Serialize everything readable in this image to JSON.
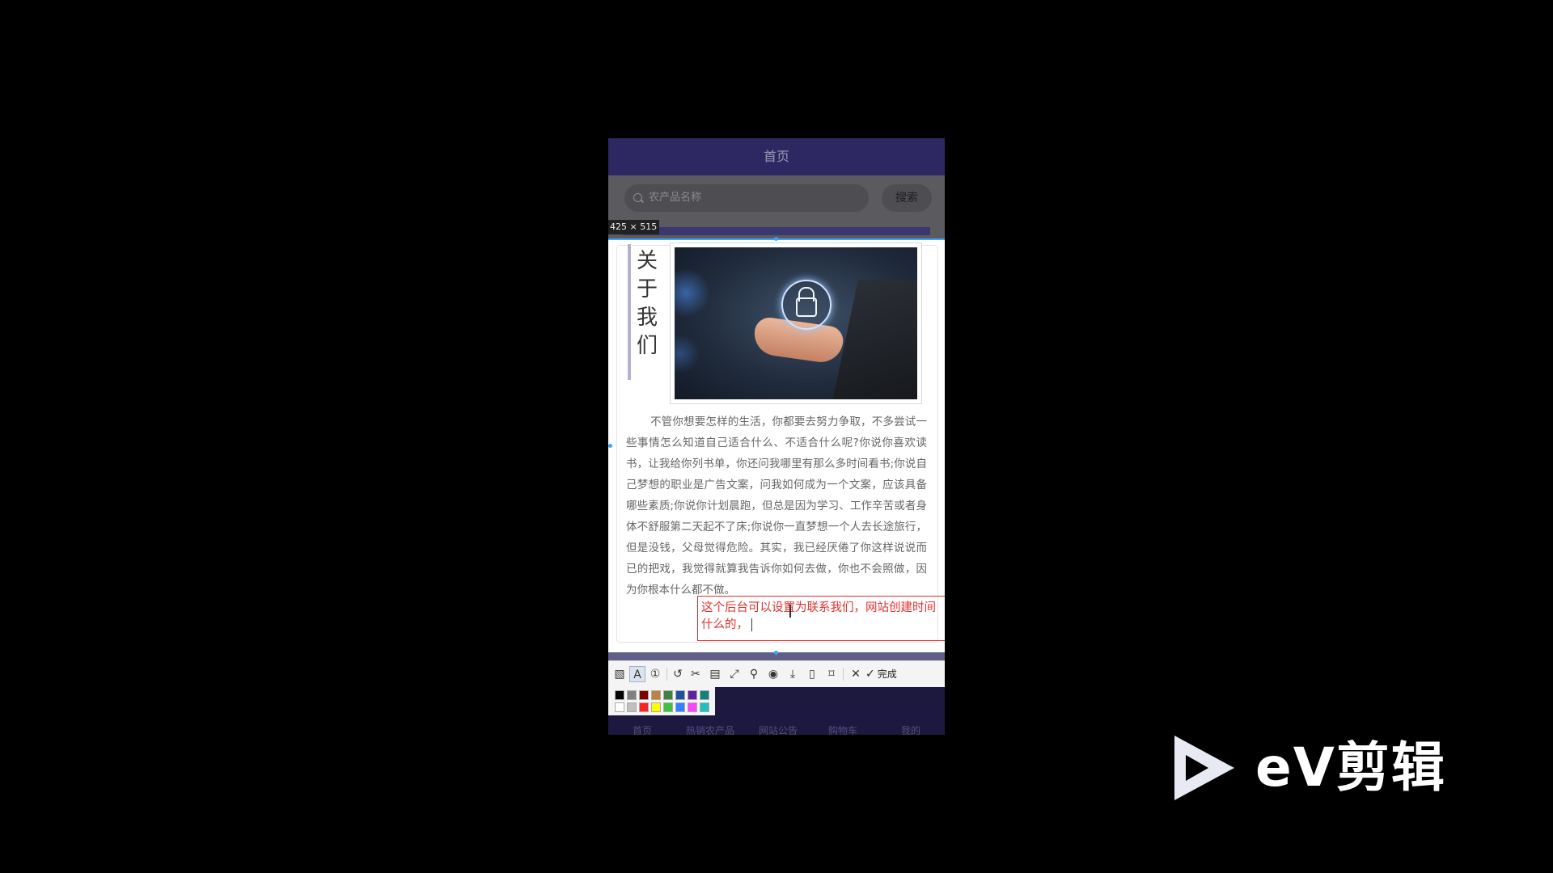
{
  "topbar": {
    "title": "首页"
  },
  "search": {
    "placeholder": "农产品名称",
    "button": "搜索"
  },
  "capture": {
    "dimensions": "425 × 515"
  },
  "about": {
    "title_chars": [
      "关",
      "于",
      "我",
      "们"
    ],
    "paragraph": "不管你想要怎样的生活，你都要去努力争取，不多尝试一些事情怎么知道自己适合什么、不适合什么呢?你说你喜欢读书，让我给你列书单，你还问我哪里有那么多时间看书;你说自己梦想的职业是广告文案，问我如何成为一个文案，应该具备哪些素质;你说你计划晨跑，但总是因为学习、工作辛苦或者身体不舒服第二天起不了床;你说你一直梦想一个人去长途旅行，但是没钱，父母觉得危险。其实，我已经厌倦了你这样说说而已的把戏，我觉得就算我告诉你如何去做，你也不会照做，因为你根本什么都不做。"
  },
  "annotation": {
    "text": "这个后台可以设置为联系我们，网站创建时间什么的，",
    "color": "#e1302f"
  },
  "toolbar": {
    "icons": [
      "mosaic-icon",
      "text-icon",
      "serial-number-icon",
      "undo-icon",
      "crop-icon",
      "ocr-icon",
      "expand-icon",
      "pin-icon",
      "record-icon",
      "download-icon",
      "long-screenshot-icon",
      "bookmark-icon",
      "close-icon"
    ],
    "done_label": "完成"
  },
  "palette": {
    "colors": [
      "#000000",
      "#808080",
      "#800000",
      "#c08040",
      "#408040",
      "#2050a0",
      "#6020a0",
      "#108080",
      "#ffffff",
      "#c0c0c0",
      "#ff2020",
      "#ffff00",
      "#40c040",
      "#3080ff",
      "#ff40ff",
      "#20c0c0"
    ]
  },
  "tabbar": {
    "items": [
      "首页",
      "热销农产品",
      "网站公告",
      "购物车",
      "我的"
    ]
  },
  "watermark": {
    "text": "eV剪辑"
  },
  "colors": {
    "topbar": "#2e2862",
    "accent": "#3aa3ff",
    "annotation": "#e1302f"
  }
}
